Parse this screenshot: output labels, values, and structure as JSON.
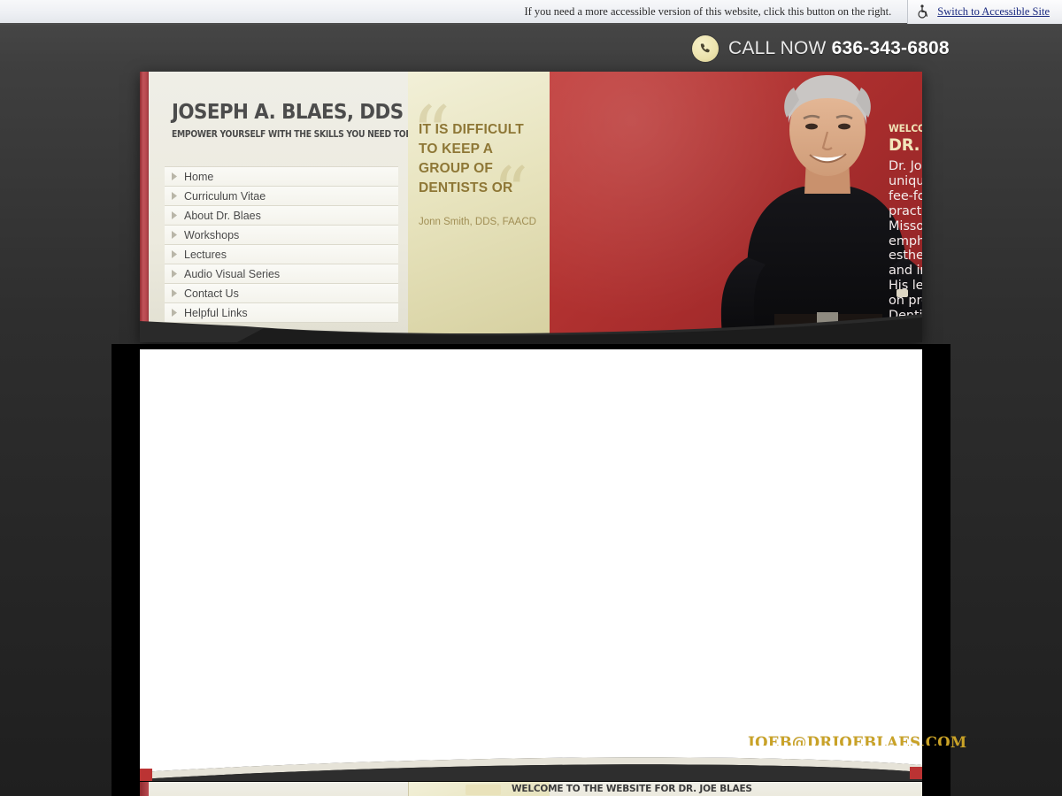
{
  "access_bar": {
    "message": "If you need a more accessible version of this website, click this button on the right.",
    "button_label": "Switch to Accessible Site",
    "icon": "wheelchair-icon"
  },
  "call_now": {
    "label": "CALL NOW",
    "phone": "636-343-6808",
    "icon": "phone-icon"
  },
  "brand": {
    "title": "JOSEPH A. BLAES, DDS",
    "tagline": "EMPOWER YOURSELF WITH THE SKILLS YOU NEED TODAY"
  },
  "nav": {
    "items": [
      {
        "label": "Home"
      },
      {
        "label": "Curriculum Vitae"
      },
      {
        "label": "About Dr. Blaes"
      },
      {
        "label": "Workshops"
      },
      {
        "label": "Lectures"
      },
      {
        "label": "Audio Visual Series"
      },
      {
        "label": "Contact Us"
      },
      {
        "label": "Helpful Links"
      }
    ]
  },
  "quote": {
    "mark": "“",
    "text": "IT IS DIFFICULT TO KEEP A GROUP OF DENTISTS OR",
    "author": "Jonn Smith, DDS, FAACD"
  },
  "welcome": {
    "eyebrow": "WELCOME TO THE WEBSITE FOR",
    "heading": "DR. JOE BLAES",
    "body": "Dr. Joe Blaes created a unique, insurance-free, fee-for-service general practice in St. Louis, Missouri, that emphasizes preventive, esthetic, reconstructive and implant dentistry.   His lectures and hands-on programs for Dentists, Dental Assistants and Hygienists have won"
  },
  "footer": {
    "email": "JOEB@DRJOEBLAES.COM",
    "repeat_heading": "WELCOME TO THE WEBSITE FOR DR. JOE BLAES"
  },
  "colors": {
    "brand_red": "#b63432",
    "accent_gold": "#c9a227",
    "quote_gold": "#8e7736",
    "panel_cream": "#eceade",
    "page_dark": "#2e2e2e",
    "link_blue": "#1b2a80"
  }
}
